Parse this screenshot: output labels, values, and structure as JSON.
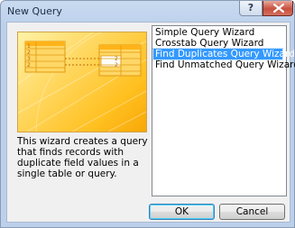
{
  "window": {
    "title": "New Query",
    "help_glyph": "?"
  },
  "wizard_list": {
    "items": [
      "Simple Query Wizard",
      "Crosstab Query Wizard",
      "Find Duplicates Query Wizard",
      "Find Unmatched Query Wizard"
    ],
    "selected_index": 2
  },
  "description": "This wizard creates a query that finds records with duplicate field values in a single table or query.",
  "buttons": {
    "ok": "OK",
    "cancel": "Cancel"
  },
  "illustration": {
    "left_table_marks": [
      "1",
      "2",
      "3",
      "2"
    ],
    "right_table_marks": [
      "2",
      "2"
    ]
  },
  "colors": {
    "selection": "#3399ff",
    "illustration_orange": "#ffc020",
    "close_red": "#c7503f"
  }
}
